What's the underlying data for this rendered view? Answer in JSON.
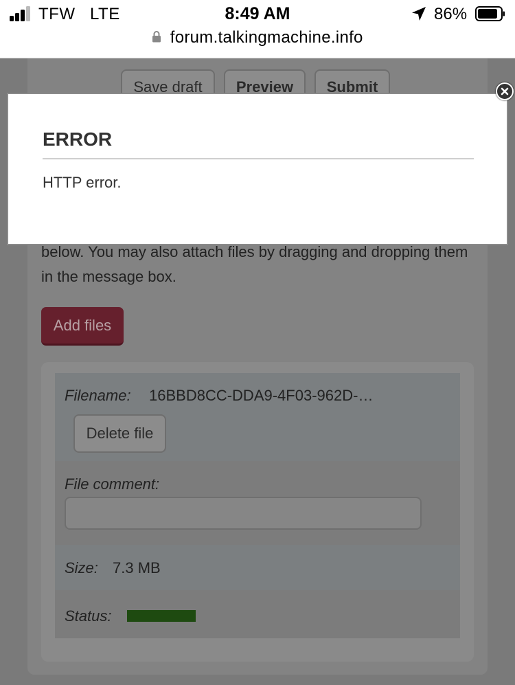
{
  "status_bar": {
    "carrier": "TFW   LTE",
    "time": "8:49 AM",
    "battery_pct": "86%",
    "icons": [
      "signal-icon",
      "location-icon",
      "battery-icon"
    ]
  },
  "url_bar": {
    "url": "forum.talkingmachine.info",
    "icon": "lock-icon"
  },
  "toolbar": {
    "save_draft_label": "Save draft",
    "preview_label": "Preview",
    "submit_label": "Submit"
  },
  "attachments": {
    "intro_text": "below. You may also attach files by dragging and dropping them in the message box.",
    "add_files_label": "Add files",
    "accent_color": "#66202d",
    "file": {
      "filename_label": "Filename:",
      "filename_value": "16BBD8CC-DDA9-4F03-962D-…",
      "delete_label": "Delete file",
      "comment_label": "File comment:",
      "comment_value": "",
      "size_label": "Size:",
      "size_value": "7.3 MB",
      "status_label": "Status:",
      "status_progress": 1.0,
      "status_color": "#1e4a10"
    }
  },
  "modal": {
    "title": "ERROR",
    "message": "HTTP error.",
    "close_icon": "close-icon"
  }
}
